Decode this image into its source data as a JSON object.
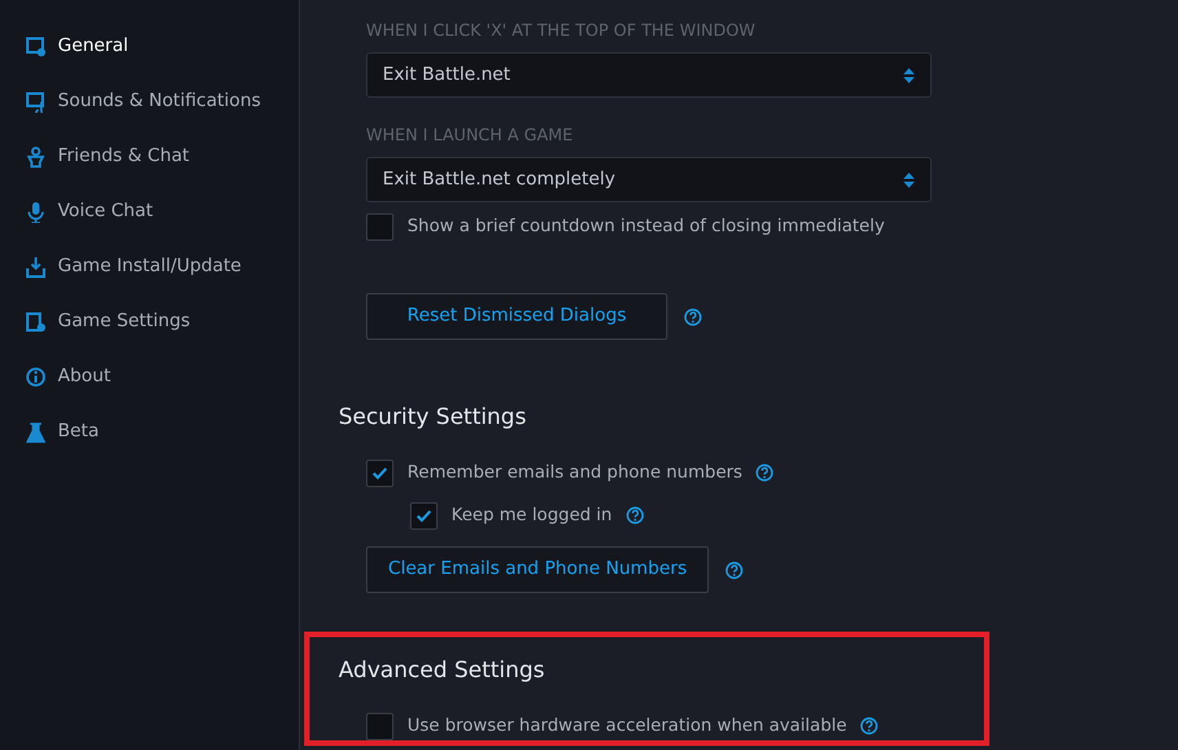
{
  "sidebar": {
    "items": [
      {
        "label": "General",
        "selected": true
      },
      {
        "label": "Sounds & Notifications",
        "selected": false
      },
      {
        "label": "Friends & Chat",
        "selected": false
      },
      {
        "label": "Voice Chat",
        "selected": false
      },
      {
        "label": "Game Install/Update",
        "selected": false
      },
      {
        "label": "Game Settings",
        "selected": false
      },
      {
        "label": "About",
        "selected": false
      },
      {
        "label": "Beta",
        "selected": false
      }
    ]
  },
  "content": [
    {
      "kind": "label",
      "text": "WHEN I CLICK 'X' AT THE TOP OF THE WINDOW"
    },
    {
      "kind": "select",
      "value": "Exit Battle.net"
    },
    {
      "kind": "label",
      "text": "WHEN I LAUNCH A GAME"
    },
    {
      "kind": "select",
      "value": "Exit Battle.net completely"
    },
    {
      "kind": "checkbox",
      "label": "Show a brief countdown instead of closing immediately",
      "checked": false,
      "help": false
    },
    {
      "kind": "button",
      "label": "Reset Dismissed Dialogs",
      "help": true
    },
    {
      "kind": "heading",
      "text": "Security Settings"
    },
    {
      "kind": "checkbox",
      "label": "Remember emails and phone numbers",
      "checked": true,
      "help": true,
      "children": [
        {
          "label": "Keep me logged in",
          "checked": true,
          "help": true
        }
      ]
    },
    {
      "kind": "button",
      "label": "Clear Emails and Phone Numbers",
      "help": true
    },
    {
      "kind": "heading",
      "text": "Advanced Settings"
    },
    {
      "kind": "checkbox",
      "label": "Use browser hardware acceleration when available",
      "checked": false,
      "help": true
    }
  ]
}
